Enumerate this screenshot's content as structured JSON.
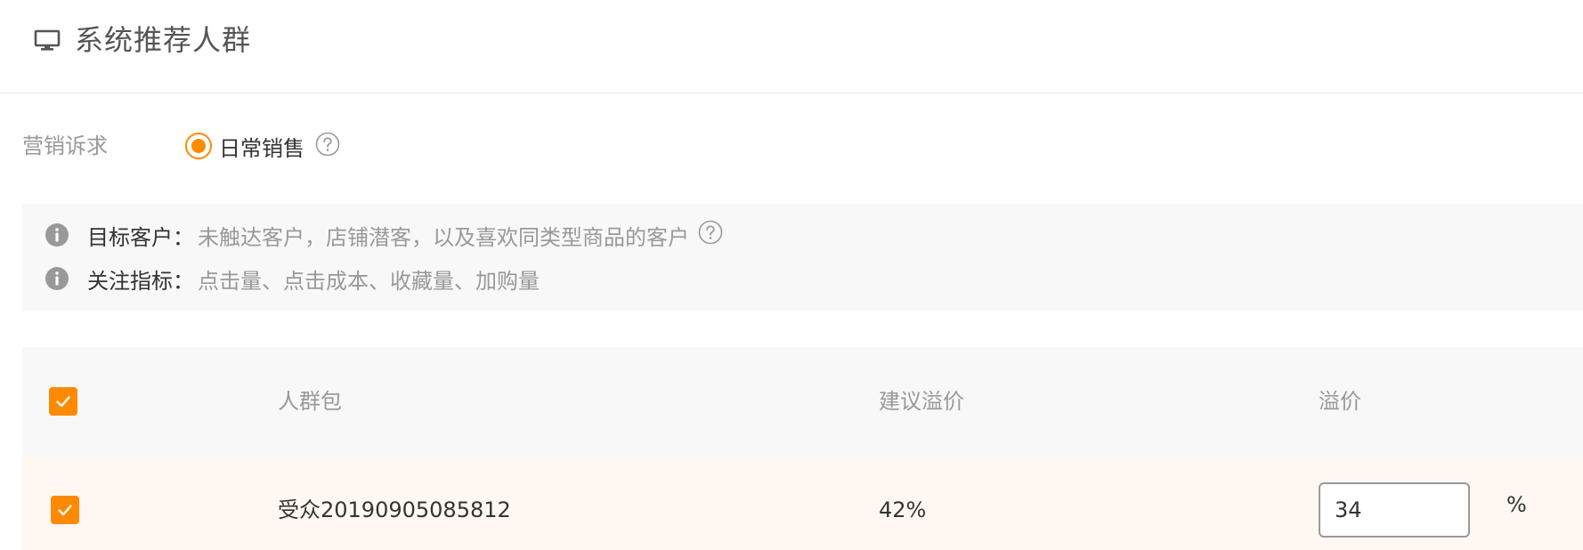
{
  "header": {
    "title": "系统推荐人群",
    "icon": "monitor-icon"
  },
  "goal": {
    "label": "营销诉求",
    "option": {
      "label": "日常销售",
      "selected": true
    }
  },
  "info": {
    "target": {
      "key": "目标客户",
      "colon": "：",
      "value": "未触达客户，店铺潜客，以及喜欢同类型商品的客户"
    },
    "metrics": {
      "key": "关注指标",
      "colon": "：",
      "value": "点击量、点击成本、收藏量、加购量"
    }
  },
  "table": {
    "headers": {
      "audience": "人群包",
      "suggested": "建议溢价",
      "premium": "溢价"
    },
    "rows": [
      {
        "checked": true,
        "name": "受众20190905085812",
        "suggested": "42%",
        "premium": "34",
        "unit": "%"
      }
    ]
  },
  "colors": {
    "accent": "#ff8a00",
    "text": "#333333",
    "muted": "#999999",
    "panel_bg": "#f8f8f8",
    "row_bg": "#fff8f2"
  }
}
